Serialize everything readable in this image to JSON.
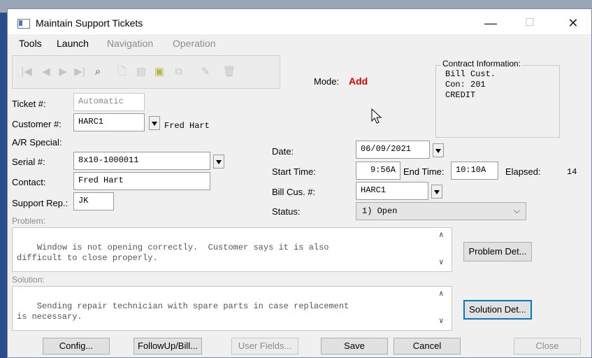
{
  "window": {
    "title": "Maintain Support Tickets",
    "controls": {
      "minimize": "—",
      "maximize": "☐",
      "close": "✕"
    }
  },
  "menu": [
    "Tools",
    "Launch",
    "Navigation",
    "Operation"
  ],
  "toolbar": {
    "buttons": [
      "first-icon",
      "prev-icon",
      "next-icon",
      "last-icon",
      "binoculars-icon",
      "new-icon",
      "filter-icon",
      "select-icon",
      "copy-icon",
      "edit-icon",
      "delete-icon"
    ]
  },
  "mode": {
    "label": "Mode:",
    "value": "Add",
    "value_color": "#e00000"
  },
  "contract": {
    "title": "Contract Information:",
    "lines": "Bill Cust.\nCon: 201\nCREDIT"
  },
  "form": {
    "ticket_label": "Ticket #:",
    "ticket_value": "Automatic",
    "customer_label": "Customer #:",
    "customer_value": "HARC1",
    "customer_name": "Fred Hart",
    "ar_special_label": "A/R Special:",
    "serial_label": "Serial #:",
    "serial_value": "8x10-1000011",
    "contact_label": "Contact:",
    "contact_value": "Fred Hart",
    "support_rep_label": "Support Rep.:",
    "support_rep_value": "JK",
    "date_label": "Date:",
    "date_value": "06/09/2021",
    "start_time_label": "Start Time:",
    "start_time_value": "9:56A",
    "end_time_label": "End Time:",
    "end_time_value": "10:10A",
    "elapsed_label": "Elapsed:",
    "elapsed_value": "14",
    "bill_cus_label": "Bill Cus. #:",
    "bill_cus_value": "HARC1",
    "status_label": "Status:",
    "status_value": "1) Open",
    "problem_label": "Problem:",
    "problem_text": "Window is not opening correctly.  Customer says it is also\ndifficult to close properly.",
    "solution_label": "Solution:",
    "solution_text": "Sending repair technician with spare parts in case replacement\nis necessary."
  },
  "buttons": {
    "problem_det": "Problem Det...",
    "solution_det": "Solution Det...",
    "config": "Config...",
    "followup": "FollowUp/Bill...",
    "user_fields": "User Fields...",
    "save": "Save",
    "cancel": "Cancel",
    "close": "Close"
  }
}
